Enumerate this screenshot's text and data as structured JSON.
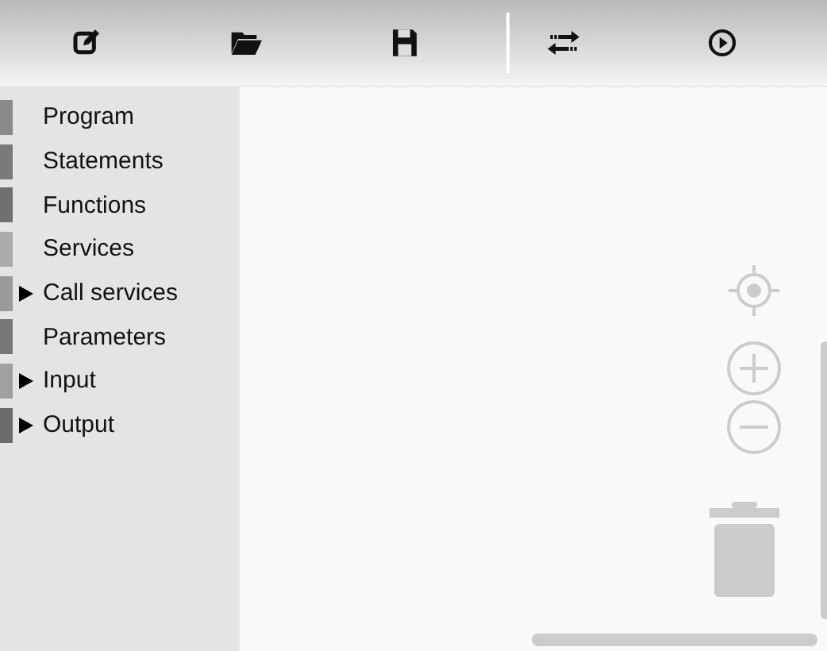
{
  "toolbar": {
    "buttons": [
      {
        "kind": "new"
      },
      {
        "kind": "open"
      },
      {
        "kind": "save"
      },
      {
        "kind": "separator"
      },
      {
        "kind": "swap"
      },
      {
        "kind": "run"
      }
    ]
  },
  "sidebar": {
    "categories": [
      {
        "label": "Program",
        "color": "#8a8a8a",
        "expandable": false
      },
      {
        "label": "Statements",
        "color": "#7a7a7a",
        "expandable": false
      },
      {
        "label": "Functions",
        "color": "#707070",
        "expandable": false
      },
      {
        "label": "Services",
        "color": "#ababab",
        "expandable": false
      },
      {
        "label": "Call services",
        "color": "#9a9a9a",
        "expandable": true,
        "expanded": false
      },
      {
        "label": "Parameters",
        "color": "#767676",
        "expandable": false
      },
      {
        "label": "Input",
        "color": "#a0a0a0",
        "expandable": true,
        "expanded": false
      },
      {
        "label": "Output",
        "color": "#6a6a6a",
        "expandable": true,
        "expanded": false
      }
    ]
  }
}
